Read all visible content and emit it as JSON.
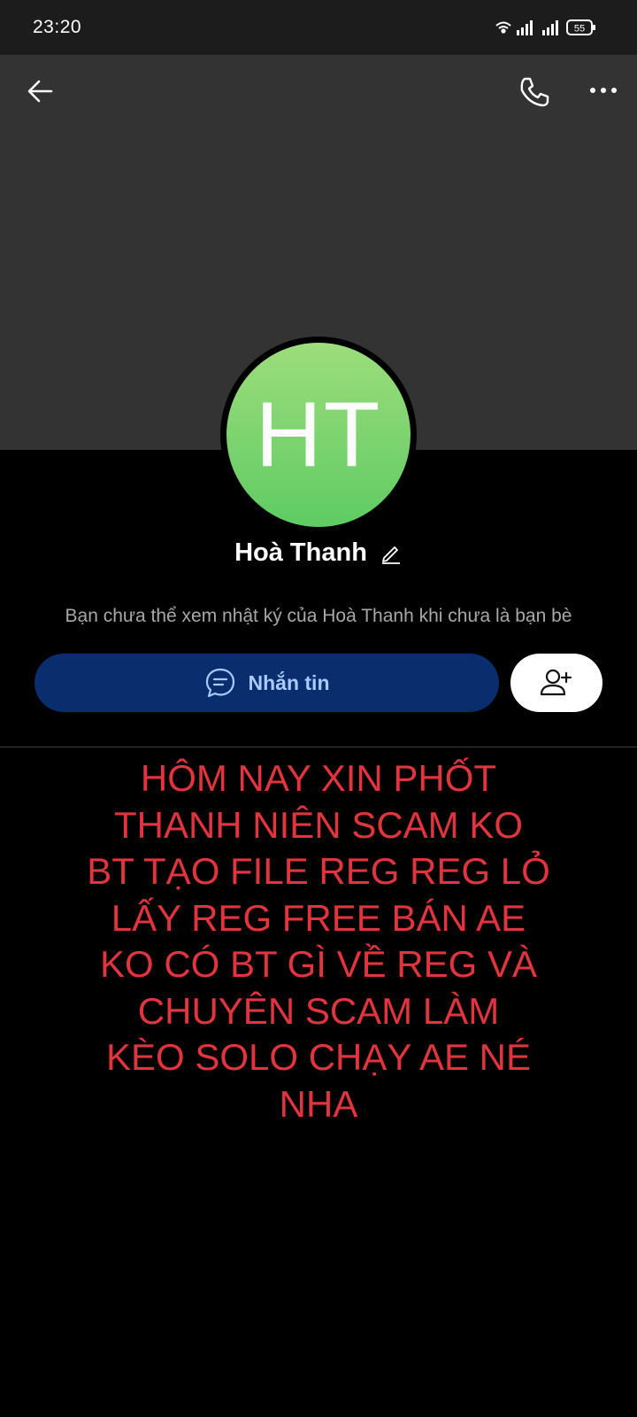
{
  "status_bar": {
    "time": "23:20",
    "battery": "55",
    "icons": [
      "wifi-icon",
      "signal-icon",
      "signal-icon",
      "battery-icon"
    ]
  },
  "header": {
    "back_icon": "arrow-left-icon",
    "call_icon": "phone-icon",
    "more_icon": "more-dots-icon"
  },
  "profile": {
    "initials": "HT",
    "name": "Hoà Thanh",
    "diary_note": "Bạn chưa thể xem nhật ký của Hoà Thanh khi chưa là bạn bè"
  },
  "actions": {
    "message_label": "Nhắn tin",
    "message_icon": "chat-bubble-icon",
    "add_friend_icon": "add-friend-icon"
  },
  "colors": {
    "accent_button": "#0a2d6e",
    "accent_text": "#a9c9ff",
    "post_text": "#e0343f",
    "avatar": "#6fd067"
  },
  "post": {
    "lines": [
      "HÔM NAY XIN PHỐT",
      "THANH NIÊN SCAM KO",
      "BT TẠO FILE REG REG LỎ",
      "LẤY REG FREE BÁN AE",
      "KO CÓ BT GÌ VỀ REG VÀ",
      "CHUYÊN SCAM LÀM",
      "KÈO SOLO CHẠY AE NÉ",
      "NHA"
    ]
  }
}
